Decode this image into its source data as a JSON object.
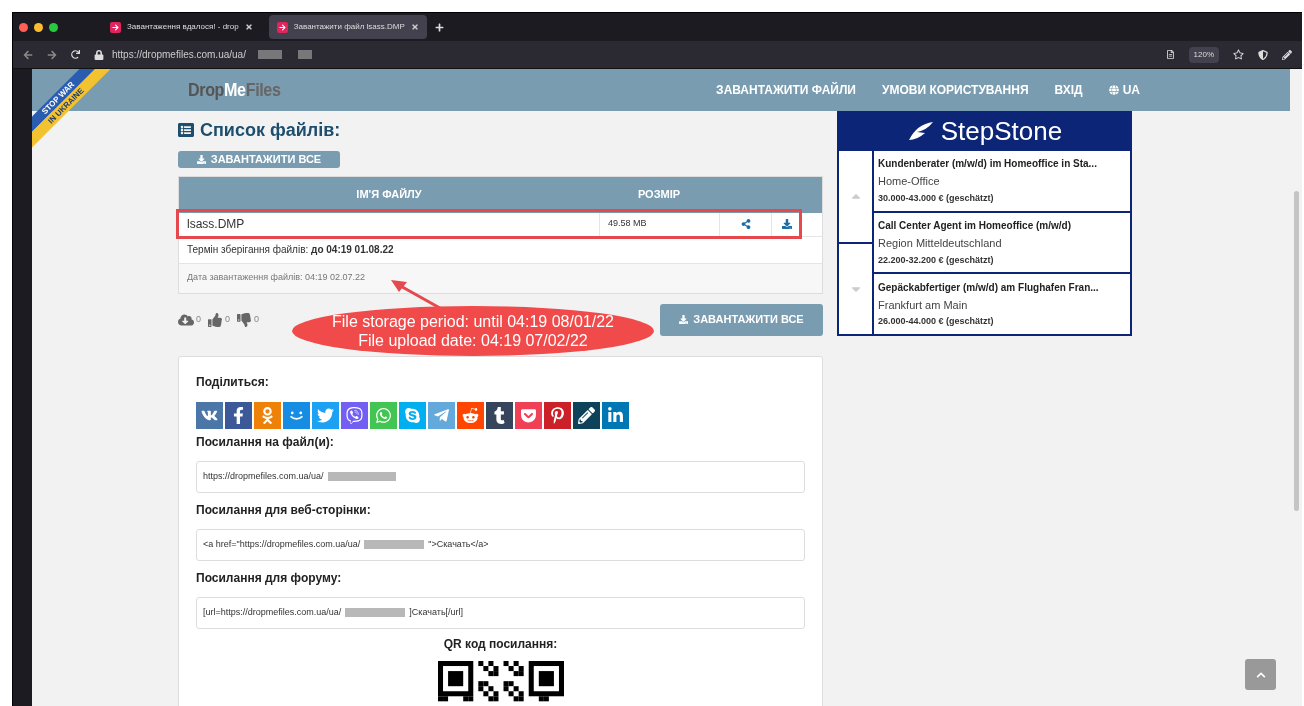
{
  "browser": {
    "tabs": [
      {
        "title": "Завантаження вдалося! - drop",
        "selected": false
      },
      {
        "title": "Завантажити файл lsass.DMP",
        "selected": true
      }
    ],
    "url": "https://dropmefiles.com.ua/ua/",
    "zoom": "120%"
  },
  "banner": {
    "lines": [
      "STOP WAR",
      "IN UKRAINE"
    ]
  },
  "header": {
    "logo": [
      "Drop",
      "Me",
      "Files"
    ],
    "nav": [
      "ЗАВАНТАЖИТИ ФАЙЛИ",
      "УМОВИ КОРИСТУВАННЯ",
      "ВХІД",
      "UA"
    ]
  },
  "files": {
    "title": "Список файлів:",
    "download_all": "ЗАВАНТАЖИТИ ВСЕ",
    "columns": [
      "ІМ'Я ФАЙЛУ",
      "РОЗМІР"
    ],
    "rows": [
      {
        "name": "lsass.DMP",
        "size": "49.58 MB"
      }
    ],
    "storage": "Термін зберігання файлів: **до 04:19 01.08.22**",
    "upload_date": "Дата завантаження файлів: 04:19 02.07.22"
  },
  "stats": [
    {
      "kind": "downloads",
      "count": "0"
    },
    {
      "kind": "likes",
      "count": "0"
    },
    {
      "kind": "dislikes",
      "count": "0"
    }
  ],
  "download_all_bottom": "ЗАВАНТАЖИТИ ВСЕ",
  "share": {
    "title": "Поділиться:",
    "services": [
      {
        "kind": "vk",
        "color": "#4a76a8"
      },
      {
        "kind": "facebook",
        "color": "#3b5998"
      },
      {
        "kind": "ok",
        "color": "#ee8208"
      },
      {
        "kind": "mailru",
        "color": "#168de2"
      },
      {
        "kind": "twitter",
        "color": "#1da1f2"
      },
      {
        "kind": "viber",
        "color": "#7360f2"
      },
      {
        "kind": "whatsapp",
        "color": "#43c553"
      },
      {
        "kind": "skype",
        "color": "#00aff0"
      },
      {
        "kind": "telegram",
        "color": "#64a9dc"
      },
      {
        "kind": "reddit",
        "color": "#ff4500"
      },
      {
        "kind": "tumblr",
        "color": "#35465c"
      },
      {
        "kind": "pocket",
        "color": "#ef4056"
      },
      {
        "kind": "pinterest",
        "color": "#cb2027"
      },
      {
        "kind": "livejournal",
        "color": "#0d425a"
      },
      {
        "kind": "linkedin",
        "color": "#0077b5"
      }
    ],
    "links": [
      {
        "label": "Посилання на файл(и):",
        "parts": [
          "https://dropmefiles.com.ua/ua/ "
        ]
      },
      {
        "label": "Посилання для веб-сторінки:",
        "parts": [
          "<a href=\"https://dropmefiles.com.ua/ua/",
          "\">Скачать</a>"
        ]
      },
      {
        "label": "Посилання для форуму:",
        "parts": [
          "[url=https://dropmefiles.com.ua/ua/",
          "]Скачать[/url]"
        ]
      }
    ],
    "qr_label": "QR код посилання:"
  },
  "ad": {
    "logo": "StepStone",
    "jobs": [
      {
        "title": "Kundenberater (m/w/d) im Homeoffice in Sta...",
        "location": "Home-Office",
        "salary": "30.000-43.000 € (geschätzt)"
      },
      {
        "title": "Call Center Agent im Homeoffice (m/w/d)",
        "location": "Region Mitteldeutschland",
        "salary": "22.200-32.200 € (geschätzt)"
      },
      {
        "title": "Gepäckabfertiger (m/w/d) am Flughafen Fran...",
        "location": "Frankfurt am Main",
        "salary": "26.000-44.000 € (geschätzt)"
      }
    ]
  },
  "annotation": {
    "lines": [
      "File storage period: until 04:19 08/01/22",
      "File upload date: 04:19 07/02/22"
    ]
  }
}
